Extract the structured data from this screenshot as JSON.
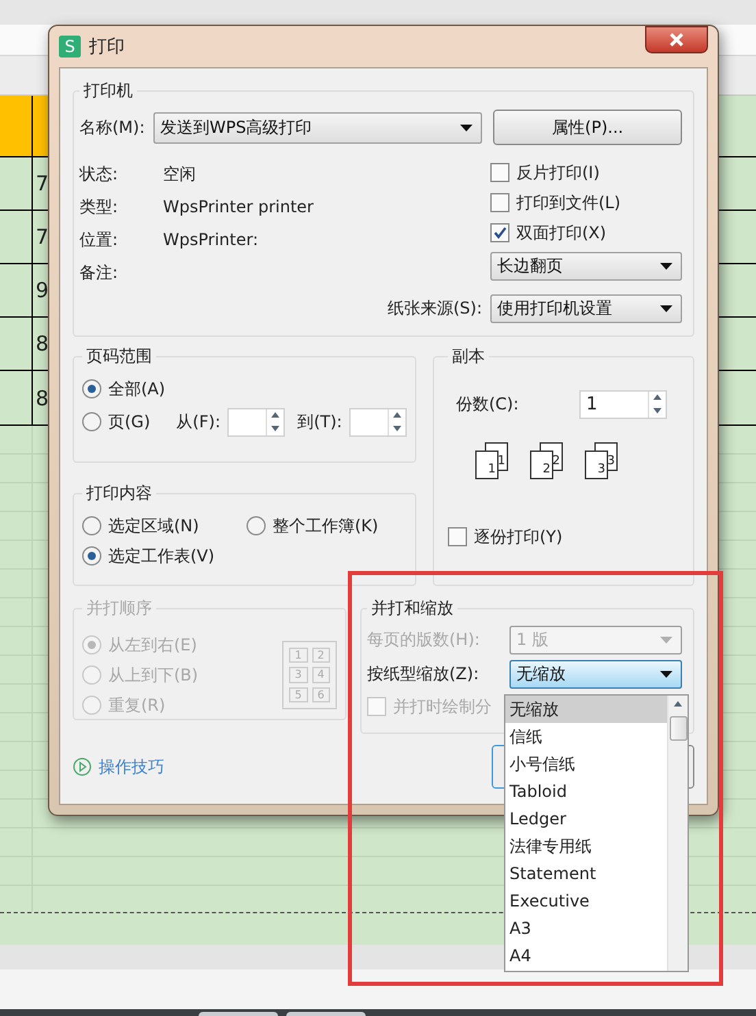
{
  "sheet": {
    "cells": [
      "7",
      "7",
      "9",
      "8",
      "8"
    ]
  },
  "dialog": {
    "title": "打印",
    "app_icon": "S",
    "printer": {
      "legend": "打印机",
      "name_label": "名称(M):",
      "name_value": "发送到WPS高级打印",
      "properties_button": "属性(P)...",
      "info": [
        {
          "label": "状态:",
          "value": "空闲"
        },
        {
          "label": "类型:",
          "value": "WpsPrinter printer"
        },
        {
          "label": "位置:",
          "value": "WpsPrinter:"
        },
        {
          "label": "备注:"
        }
      ],
      "options": [
        {
          "label": "反片打印(I)",
          "checked": false
        },
        {
          "label": "打印到文件(L)",
          "checked": false
        },
        {
          "label": "双面打印(X)",
          "checked": true
        }
      ],
      "duplex_value": "长边翻页",
      "paper_source_label": "纸张来源(S):",
      "paper_source_value": "使用打印机设置"
    },
    "page_range": {
      "legend": "页码范围",
      "options": [
        {
          "label": "全部(A)",
          "selected": true
        },
        {
          "label": "页(G)",
          "selected": false
        }
      ],
      "from_label": "从(F):",
      "to_label": "到(T):"
    },
    "print_content": {
      "legend": "打印内容",
      "options": [
        {
          "label": "选定区域(N)",
          "selected": false
        },
        {
          "label": "整个工作簿(K)",
          "selected": false
        },
        {
          "label": "选定工作表(V)",
          "selected": true
        }
      ]
    },
    "collate_order": {
      "legend": "并打顺序",
      "disabled": true,
      "options": [
        {
          "label": "从左到右(E)",
          "selected": true
        },
        {
          "label": "从上到下(B)",
          "selected": false
        },
        {
          "label": "重复(R)",
          "selected": false
        }
      ],
      "preview_numbers": [
        "1",
        "2",
        "3",
        "4",
        "5",
        "6"
      ]
    },
    "copies": {
      "legend": "副本",
      "count_label": "份数(C):",
      "count_value": "1",
      "collate_icons": [
        {
          "back": "1",
          "front": "1"
        },
        {
          "back": "2",
          "front": "2"
        },
        {
          "back": "3",
          "front": "3"
        }
      ],
      "collate_label": "逐份打印(Y)",
      "collate_checked": false
    },
    "scaling": {
      "legend": "并打和缩放",
      "pages_label": "每页的版数(H):",
      "pages_value": "1 版",
      "pages_disabled": true,
      "scale_label": "按纸型缩放(Z):",
      "scale_value": "无缩放",
      "borders_label": "并打时绘制分",
      "borders_checked": false
    },
    "tips_link": "操作技巧"
  },
  "dropdown": {
    "items": [
      {
        "label": "无缩放",
        "selected": true
      },
      {
        "label": "信纸",
        "selected": false
      },
      {
        "label": "小号信纸",
        "selected": false
      },
      {
        "label": "Tabloid",
        "selected": false
      },
      {
        "label": "Ledger",
        "selected": false
      },
      {
        "label": "法律专用纸",
        "selected": false
      },
      {
        "label": "Statement",
        "selected": false
      },
      {
        "label": "Executive",
        "selected": false
      },
      {
        "label": "A3",
        "selected": false
      },
      {
        "label": "A4",
        "selected": false
      }
    ]
  }
}
